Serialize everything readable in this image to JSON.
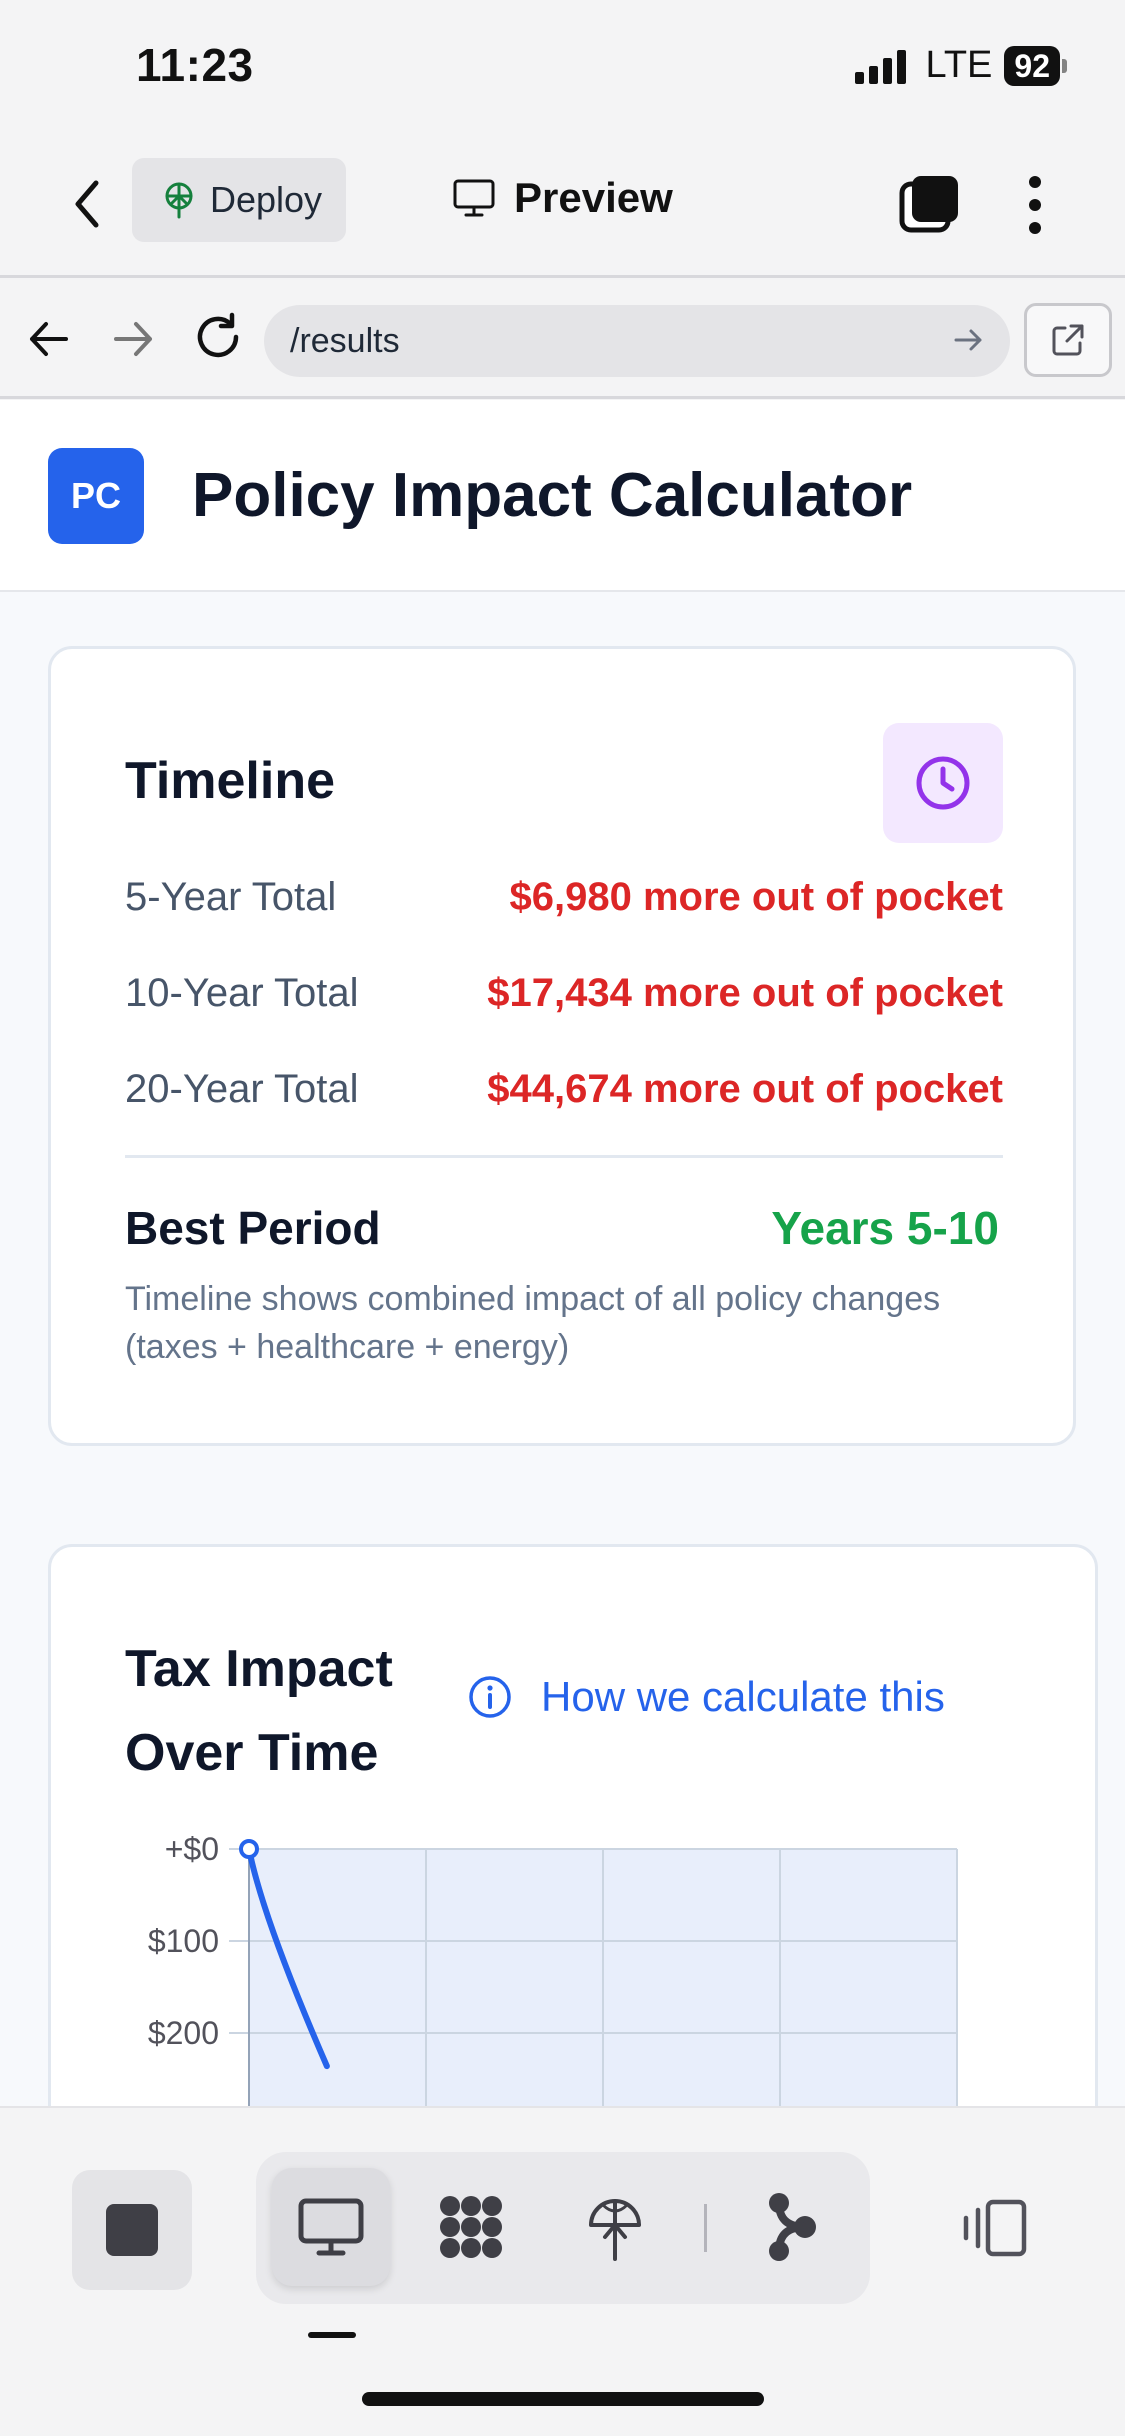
{
  "status_bar": {
    "time": "11:23",
    "network": "LTE",
    "battery": "92"
  },
  "app_bar": {
    "deploy_label": "Deploy",
    "preview_label": "Preview"
  },
  "browser": {
    "url": "/results"
  },
  "header": {
    "logo_text": "PC",
    "title": "Policy Impact Calculator"
  },
  "timeline": {
    "title": "Timeline",
    "rows": [
      {
        "label": "5-Year Total",
        "value": "$6,980 more out of pocket"
      },
      {
        "label": "10-Year Total",
        "value": "$17,434 more out of pocket"
      },
      {
        "label": "20-Year Total",
        "value": "$44,674 more out of pocket"
      }
    ],
    "best_period_label": "Best Period",
    "best_period_value": "Years 5-10",
    "note": "Timeline shows combined impact of all policy changes (taxes + healthcare + energy)"
  },
  "tax_impact": {
    "title_line1": "Tax Impact",
    "title_line2": "Over Time",
    "how_link": "How we calculate this"
  },
  "chart_data": {
    "type": "area",
    "y_tick_labels": [
      "+$0",
      "$100",
      "$200"
    ],
    "x": [
      0,
      0.44
    ],
    "y": [
      0,
      -236
    ]
  },
  "colors": {
    "accent": "#2563eb",
    "negative": "#dc2626",
    "positive": "#16a34a",
    "clock_bg": "#f3e8ff",
    "clock": "#9333ea"
  }
}
